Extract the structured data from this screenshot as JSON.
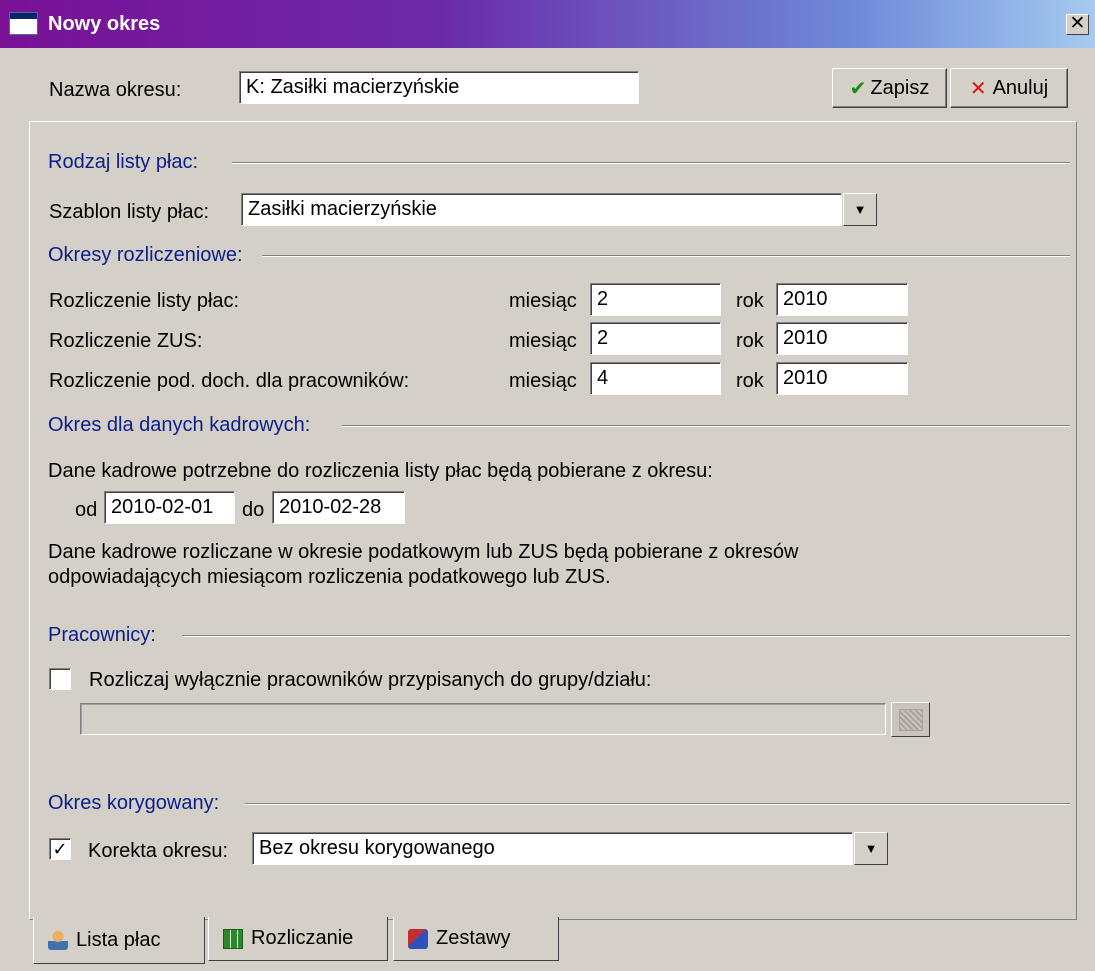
{
  "window": {
    "title": "Nowy okres"
  },
  "header": {
    "name_label": "Nazwa okresu:",
    "name_value": "K: Zasiłki macierzyńskie",
    "save_label": "Zapisz",
    "cancel_label": "Anuluj"
  },
  "payroll_type": {
    "section": "Rodzaj listy płac:",
    "template_label": "Szablon listy płac:",
    "template_value": "Zasiłki macierzyńskie"
  },
  "settlement": {
    "section": "Okresy rozliczeniowe:",
    "month_label": "miesiąc",
    "year_label": "rok",
    "rows": [
      {
        "label": "Rozliczenie listy płac:",
        "month": "2",
        "year": "2010"
      },
      {
        "label": "Rozliczenie ZUS:",
        "month": "2",
        "year": "2010"
      },
      {
        "label": "Rozliczenie pod. doch. dla pracowników:",
        "month": "4",
        "year": "2010"
      }
    ]
  },
  "hr_period": {
    "section": "Okres dla danych kadrowych:",
    "info": "Dane kadrowe potrzebne do rozliczenia listy płac będą pobierane z okresu:",
    "from_label": "od",
    "from_value": "2010-02-01",
    "to_label": "do",
    "to_value": "2010-02-28",
    "note_line1": "Dane kadrowe rozliczane w okresie podatkowym lub ZUS będą pobierane z okresów",
    "note_line2": "odpowiadających miesiącom rozliczenia podatkowego lub ZUS."
  },
  "employees": {
    "section": "Pracownicy:",
    "checkbox_label": "Rozliczaj wyłącznie pracowników przypisanych do grupy/działu:",
    "checked": false
  },
  "corrected": {
    "section": "Okres korygowany:",
    "checkbox_label": "Korekta okresu:",
    "checked": true,
    "value": "Bez okresu korygowanego"
  },
  "tabs": [
    {
      "label": "Lista płac",
      "icon": "person-icon"
    },
    {
      "label": "Rozliczanie",
      "icon": "spreadsheet-icon"
    },
    {
      "label": "Zestawy",
      "icon": "sets-icon"
    }
  ],
  "colors": {
    "section_text": "#0a1e8c",
    "title_bar_start": "#7a1196",
    "title_bar_end": "#a6caf0",
    "window_bg": "#d4d0c8"
  }
}
